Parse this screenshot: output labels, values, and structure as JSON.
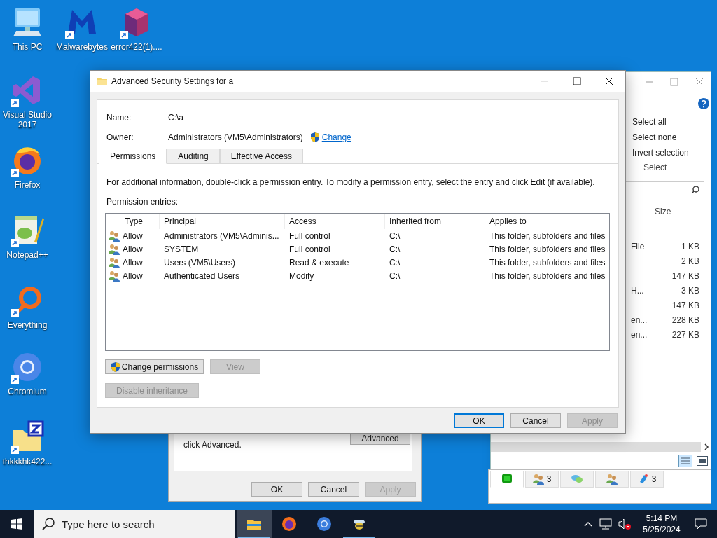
{
  "desktop_icons": [
    {
      "label": "This PC"
    },
    {
      "label": "Malwarebytes"
    },
    {
      "label": "error422(1)...."
    },
    {
      "label": "Visual Studio 2017"
    },
    {
      "label": "Firefox"
    },
    {
      "label": "Notepad++"
    },
    {
      "label": "Everything"
    },
    {
      "label": "Chromium"
    },
    {
      "label": "thkkkhk422..."
    }
  ],
  "explorer_window": {
    "ribbon_items": [
      "Select all",
      "Select none",
      "Invert selection"
    ],
    "ribbon_group": "Select",
    "size_column": "Size",
    "rows": [
      {
        "type": "File",
        "size": "1 KB"
      },
      {
        "size": "2 KB"
      },
      {
        "size": "147 KB"
      },
      {
        "type": "H...",
        "size": "3 KB"
      },
      {
        "size": "147 KB"
      },
      {
        "type": "en...",
        "size": "228 KB"
      },
      {
        "type": "en...",
        "size": "227 KB"
      }
    ]
  },
  "properties_dialog": {
    "text": "click Advanced.",
    "advanced_button": "Advanced",
    "buttons": [
      {
        "label": "OK",
        "disabled": false
      },
      {
        "label": "Cancel",
        "disabled": false
      },
      {
        "label": "Apply",
        "disabled": true
      }
    ]
  },
  "chat_window": {
    "tabs": [
      {
        "selected": true
      },
      {
        "count": "3",
        "selected": false
      },
      {
        "selected": false
      },
      {
        "selected": false
      },
      {
        "count": "3",
        "selected": false
      }
    ]
  },
  "dialog": {
    "title": "Advanced Security Settings for a",
    "name_label": "Name:",
    "name_value": "C:\\a",
    "owner_label": "Owner:",
    "owner_value": "Administrators (VM5\\Administrators)",
    "change_link": "Change",
    "tabs": [
      {
        "label": "Permissions",
        "selected": true
      },
      {
        "label": "Auditing",
        "selected": false
      },
      {
        "label": "Effective Access",
        "selected": false
      }
    ],
    "info": "For additional information, double-click a permission entry. To modify a permission entry, select the entry and click Edit (if available).",
    "entries_label": "Permission entries:",
    "columns": [
      "Type",
      "Principal",
      "Access",
      "Inherited from",
      "Applies to"
    ],
    "rows": [
      {
        "type": "Allow",
        "principal": "Administrators (VM5\\Adminis...",
        "access": "Full control",
        "inherited_from": "C:\\",
        "applies_to": "This folder, subfolders and files"
      },
      {
        "type": "Allow",
        "principal": "SYSTEM",
        "access": "Full control",
        "inherited_from": "C:\\",
        "applies_to": "This folder, subfolders and files"
      },
      {
        "type": "Allow",
        "principal": "Users (VM5\\Users)",
        "access": "Read & execute",
        "inherited_from": "C:\\",
        "applies_to": "This folder, subfolders and files"
      },
      {
        "type": "Allow",
        "principal": "Authenticated Users",
        "access": "Modify",
        "inherited_from": "C:\\",
        "applies_to": "This folder, subfolders and files"
      }
    ],
    "action_buttons": [
      {
        "label": "Change permissions",
        "shield": true,
        "disabled": false
      },
      {
        "label": "View",
        "shield": false,
        "disabled": true
      }
    ],
    "inheritance_button": {
      "label": "Disable inheritance",
      "disabled": true
    },
    "footer_buttons": [
      {
        "label": "OK",
        "default": true,
        "disabled": false
      },
      {
        "label": "Cancel",
        "default": false,
        "disabled": false
      },
      {
        "label": "Apply",
        "default": false,
        "disabled": true
      }
    ]
  },
  "taskbar": {
    "search_placeholder": "Type here to search",
    "apps": [
      {
        "selected": true,
        "running": true
      },
      {
        "selected": false,
        "running": false
      },
      {
        "selected": false,
        "running": false
      },
      {
        "selected": false,
        "running": true
      }
    ],
    "time": "5:14 PM",
    "date": "5/25/2024"
  }
}
